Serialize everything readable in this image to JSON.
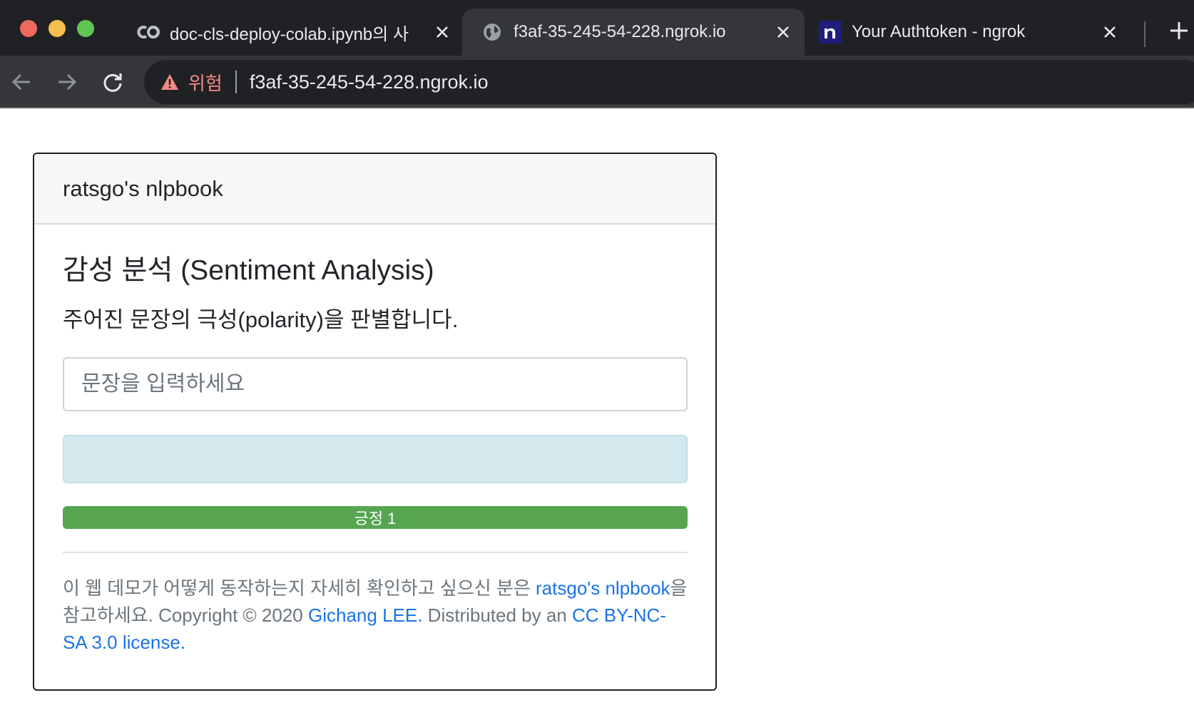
{
  "browser": {
    "tabs": [
      {
        "title": "doc-cls-deploy-colab.ipynb의 사",
        "favicon": "colab-icon",
        "active": false
      },
      {
        "title": "f3af-35-245-54-228.ngrok.io",
        "favicon": "globe-icon",
        "active": true
      },
      {
        "title": "Your Authtoken - ngrok",
        "favicon": "ngrok-icon",
        "active": false
      }
    ],
    "security_label": "위험",
    "url": "f3af-35-245-54-228.ngrok.io"
  },
  "page": {
    "brand": "ratsgo's nlpbook",
    "heading": "감성 분석 (Sentiment Analysis)",
    "description": "주어진 문장의 극성(polarity)을 판별합니다.",
    "input_placeholder": "문장을 입력하세요",
    "result": {
      "label": "긍정 1",
      "value": 1.0,
      "color": "#55a551"
    },
    "footer": {
      "part1": "이 웹 데모가 어떻게 동작하는지 자세히 확인하고 싶으신 분은 ",
      "link1": "ratsgo's nlpbook",
      "part2": "을 참고하세요. Copyright © 2020 ",
      "link2": "Gichang LEE.",
      "part3": " Distributed by an ",
      "link3": "CC BY-NC-SA 3.0 license."
    }
  }
}
